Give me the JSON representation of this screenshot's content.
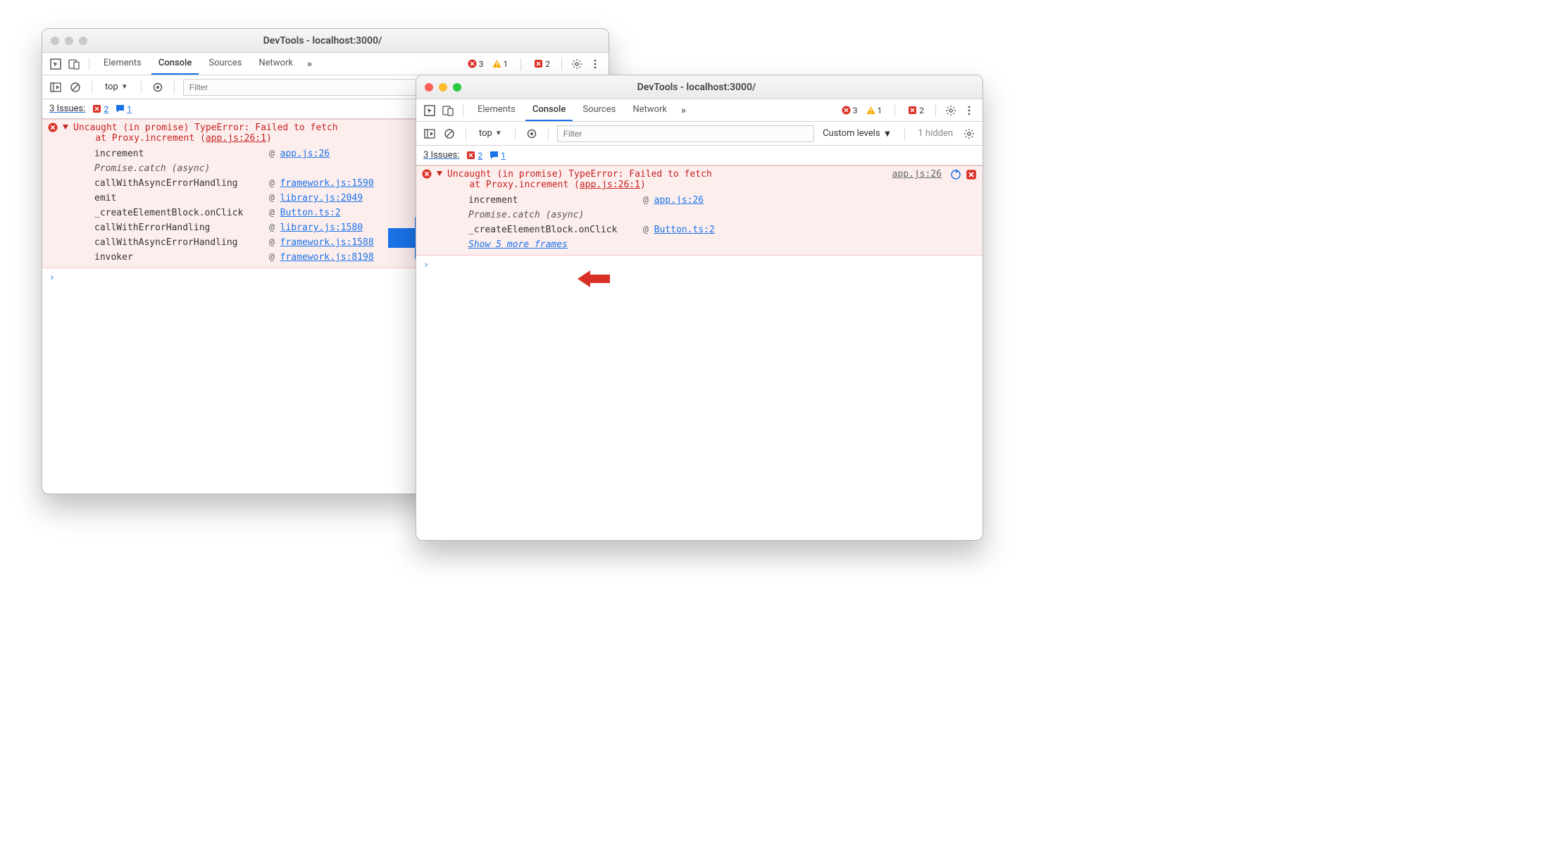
{
  "arrow": {
    "description_blue": "transition-arrow",
    "description_red": "highlight-arrow"
  },
  "windows": {
    "left": {
      "title": "DevTools - localhost:3000/",
      "traffic_style": "grey",
      "tabs": {
        "items": [
          "Elements",
          "Console",
          "Sources",
          "Network"
        ],
        "active": "Console",
        "more": "»"
      },
      "counts": {
        "errors": "3",
        "warnings": "1",
        "flags": "2"
      },
      "toolbar": {
        "context": "top",
        "filter_placeholder": "Filter",
        "show_levels": false
      },
      "issues": {
        "label": "3 Issues:",
        "flags": "2",
        "messages": "1"
      },
      "error": {
        "title_line1": "Uncaught (in promise) TypeError: Failed to fetch",
        "title_line2_pre": "at Proxy.increment (",
        "title_line2_link": "app.js:26:1",
        "title_line2_post": ")",
        "show_src_link": false,
        "show_side_icons": false,
        "stack": [
          {
            "name": "increment",
            "src": "app.js:26"
          },
          {
            "async": "Promise.catch (async)"
          },
          {
            "name": "callWithAsyncErrorHandling",
            "src": "framework.js:1590"
          },
          {
            "name": "emit",
            "src": "library.js:2049"
          },
          {
            "name": "_createElementBlock.onClick",
            "src": "Button.ts:2"
          },
          {
            "name": "callWithErrorHandling",
            "src": "library.js:1580"
          },
          {
            "name": "callWithAsyncErrorHandling",
            "src": "framework.js:1588"
          },
          {
            "name": "invoker",
            "src": "framework.js:8198"
          }
        ]
      }
    },
    "right": {
      "title": "DevTools - localhost:3000/",
      "traffic_style": "color",
      "tabs": {
        "items": [
          "Elements",
          "Console",
          "Sources",
          "Network"
        ],
        "active": "Console",
        "more": "»"
      },
      "counts": {
        "errors": "3",
        "warnings": "1",
        "flags": "2"
      },
      "toolbar": {
        "context": "top",
        "filter_placeholder": "Filter",
        "show_levels": true,
        "levels_label": "Custom levels",
        "hidden_label": "1 hidden"
      },
      "issues": {
        "label": "3 Issues:",
        "flags": "2",
        "messages": "1"
      },
      "error": {
        "title_line1": "Uncaught (in promise) TypeError: Failed to fetch",
        "title_line2_pre": "at Proxy.increment (",
        "title_line2_link": "app.js:26:1",
        "title_line2_post": ")",
        "show_src_link": true,
        "src_link": "app.js:26",
        "show_side_icons": true,
        "stack": [
          {
            "name": "increment",
            "src": "app.js:26"
          },
          {
            "async": "Promise.catch (async)"
          },
          {
            "name": "_createElementBlock.onClick",
            "src": "Button.ts:2"
          }
        ],
        "show_more": "Show 5 more frames"
      }
    }
  }
}
